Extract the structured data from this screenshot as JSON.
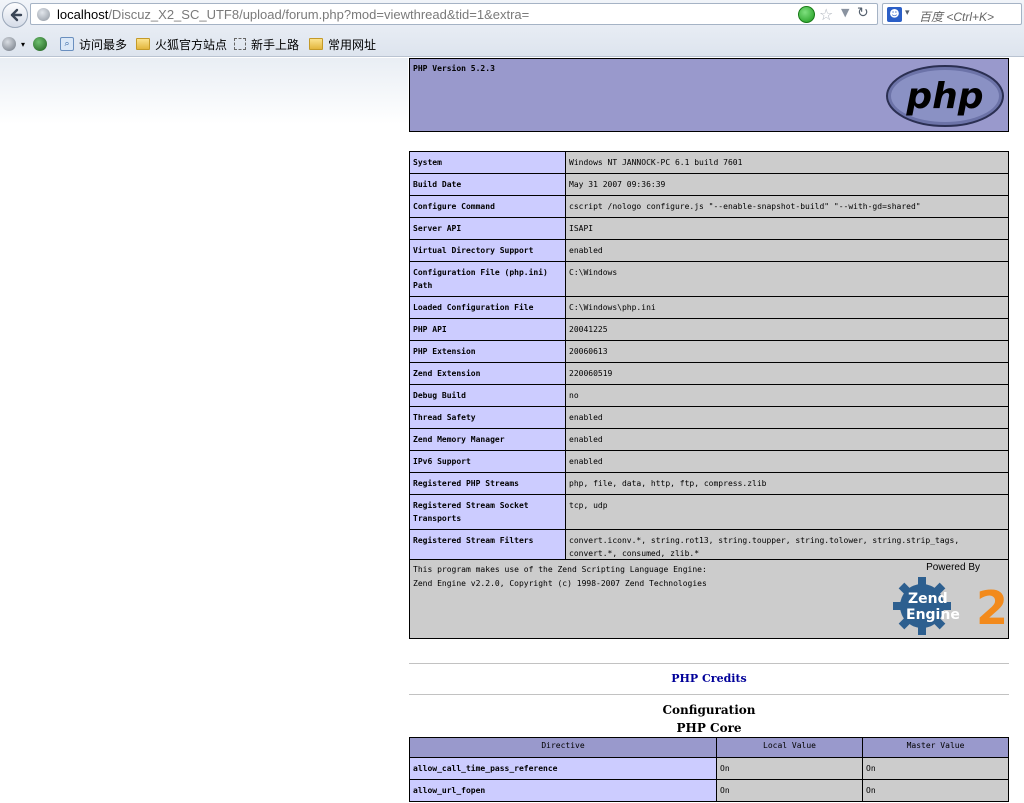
{
  "browser": {
    "url_host": "localhost",
    "url_path": "/Discuz_X2_SC_UTF8/upload/forum.php?mod=viewthread&tid=1&extra=",
    "search_placeholder": "百度 <Ctrl+K>",
    "bookmarks": [
      "访问最多",
      "火狐官方站点",
      "新手上路",
      "常用网址"
    ]
  },
  "phpinfo": {
    "version_title": "PHP Version 5.2.3",
    "logo_text": "php",
    "system_rows": [
      {
        "name": "System",
        "value": "Windows NT JANNOCK-PC 6.1 build 7601"
      },
      {
        "name": "Build Date",
        "value": "May 31 2007 09:36:39"
      },
      {
        "name": "Configure Command",
        "value": "cscript /nologo configure.js \"--enable-snapshot-build\" \"--with-gd=shared\""
      },
      {
        "name": "Server API",
        "value": "ISAPI"
      },
      {
        "name": "Virtual Directory Support",
        "value": "enabled"
      },
      {
        "name": "Configuration File (php.ini) Path",
        "value": "C:\\Windows"
      },
      {
        "name": "Loaded Configuration File",
        "value": "C:\\Windows\\php.ini"
      },
      {
        "name": "PHP API",
        "value": "20041225"
      },
      {
        "name": "PHP Extension",
        "value": "20060613"
      },
      {
        "name": "Zend Extension",
        "value": "220060519"
      },
      {
        "name": "Debug Build",
        "value": "no"
      },
      {
        "name": "Thread Safety",
        "value": "enabled"
      },
      {
        "name": "Zend Memory Manager",
        "value": "enabled"
      },
      {
        "name": "IPv6 Support",
        "value": "enabled"
      },
      {
        "name": "Registered PHP Streams",
        "value": "php, file, data, http, ftp, compress.zlib"
      },
      {
        "name": "Registered Stream Socket Transports",
        "value": "tcp, udp"
      },
      {
        "name": "Registered Stream Filters",
        "value": "convert.iconv.*, string.rot13, string.toupper, string.tolower, string.strip_tags, convert.*, consumed, zlib.*"
      }
    ],
    "zend": {
      "line1": "This program makes use of the Zend Scripting Language Engine:",
      "line2": "Zend Engine v2.2.0, Copyright (c) 1998-2007 Zend Technologies",
      "powered_by": "Powered By",
      "logo_word1": "Zend",
      "logo_word2": "Engine",
      "logo_num": "2"
    },
    "credits_link": "PHP Credits",
    "configuration_heading": "Configuration",
    "core_heading": "PHP Core",
    "core_columns": [
      "Directive",
      "Local Value",
      "Master Value"
    ],
    "core_rows": [
      {
        "directive": "allow_call_time_pass_reference",
        "local": "On",
        "master": "On"
      },
      {
        "directive": "allow_url_fopen",
        "local": "On",
        "master": "On"
      }
    ]
  }
}
